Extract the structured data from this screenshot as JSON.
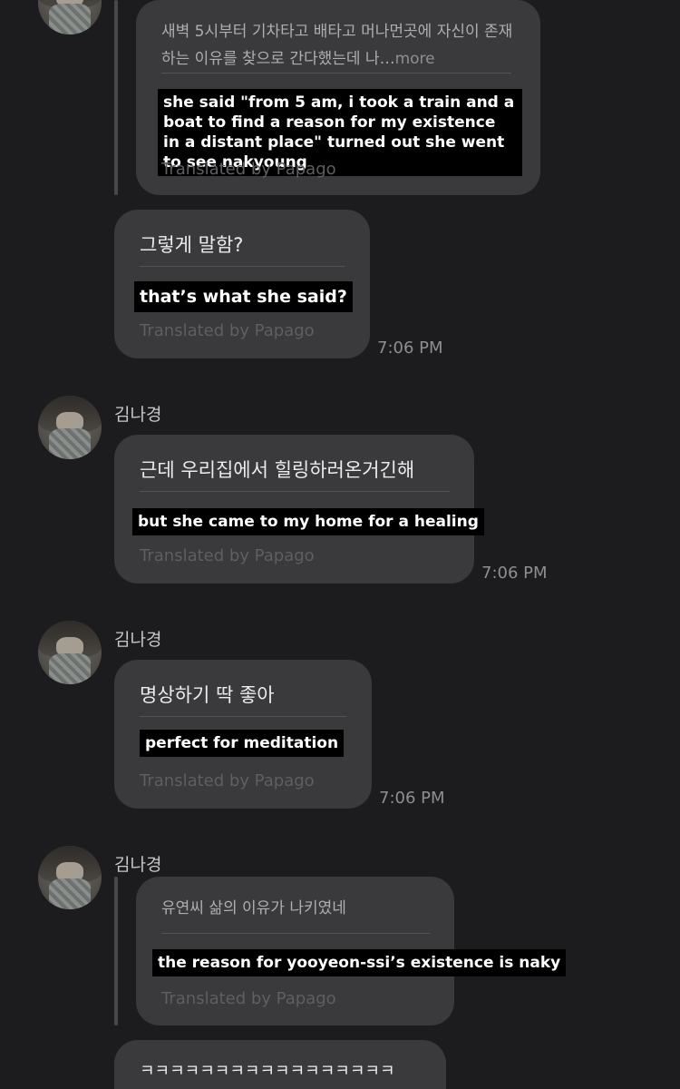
{
  "messages": {
    "m1": {
      "original": "새벽 5시부터 기차타고 배타고 머나먼곳에 자신이 존재하는 이유를 찾으로 간다했는데 나…",
      "more": "more",
      "caption": "she said \"from 5 am, i took a train and a boat to find a reason for my existence in a distant place\" turned out she went to see nakyoung",
      "translated": "Translated by Papago"
    },
    "m2": {
      "original": "그렇게 말함?",
      "caption": "that’s what she said?",
      "translated": "Translated by Papago",
      "time": "7:06 PM"
    },
    "m3": {
      "sender": "김나경",
      "original": "근데 우리집에서 힐링하러온거긴해",
      "caption": "but she came to my home for a healing",
      "translated": "Translated by Papago",
      "time": "7:06 PM"
    },
    "m4": {
      "sender": "김나경",
      "original": "명상하기 딱 좋아",
      "caption": "perfect for meditation",
      "translated": "Translated by Papago",
      "time": "7:06 PM"
    },
    "m5": {
      "sender": "김나경",
      "original": "유연씨 삶의 이유가 나키였네",
      "caption": "the reason for yooyeon-ssi’s existence is naky",
      "translated": "Translated by Papago"
    },
    "m6": {
      "original": "ㅋㅋㅋㅋㅋㅋㅋㅋㅋㅋㅋㅋㅋㅋㅋㅋㅋ"
    }
  }
}
